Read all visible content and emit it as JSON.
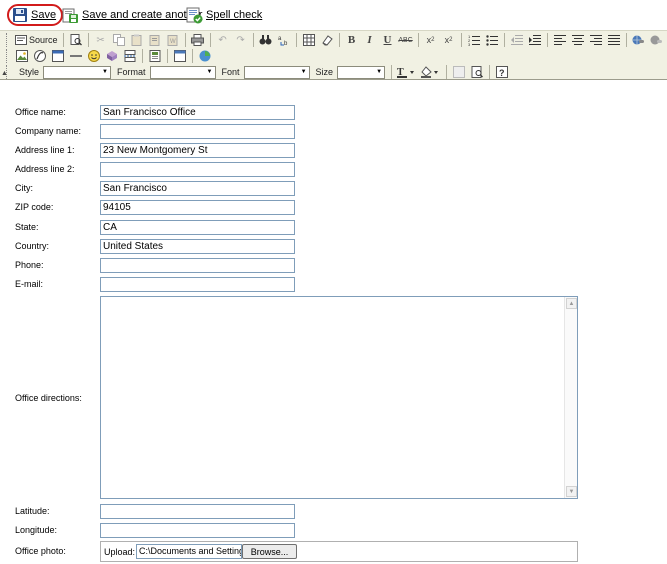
{
  "actions": {
    "save_label": "Save",
    "save_and_create_label": "Save and create another",
    "spell_check_label": "Spell check"
  },
  "editor_toolbar": {
    "source_label": "Source",
    "style_label": "Style",
    "format_label": "Format",
    "font_label": "Font",
    "size_label": "Size",
    "style_value": "",
    "format_value": "",
    "font_value": "",
    "size_value": ""
  },
  "form": {
    "office_name": {
      "label": "Office name:",
      "value": "San Francisco Office"
    },
    "company_name": {
      "label": "Company name:",
      "value": ""
    },
    "address_line_1": {
      "label": "Address line 1:",
      "value": "23 New Montgomery St"
    },
    "address_line_2": {
      "label": "Address line 2:",
      "value": ""
    },
    "city": {
      "label": "City:",
      "value": "San Francisco"
    },
    "zip_code": {
      "label": "ZIP code:",
      "value": "94105"
    },
    "state": {
      "label": "State:",
      "value": "CA"
    },
    "country": {
      "label": "Country:",
      "value": "United States"
    },
    "phone": {
      "label": "Phone:",
      "value": ""
    },
    "email": {
      "label": "E-mail:",
      "value": ""
    },
    "office_directions": {
      "label": "Office directions:",
      "value": ""
    },
    "latitude": {
      "label": "Latitude:",
      "value": ""
    },
    "longitude": {
      "label": "Longitude:",
      "value": ""
    },
    "office_photo": {
      "label": "Office photo:",
      "upload_label": "Upload:",
      "path": "C:\\Documents and Settings",
      "browse_label": "Browse..."
    }
  }
}
